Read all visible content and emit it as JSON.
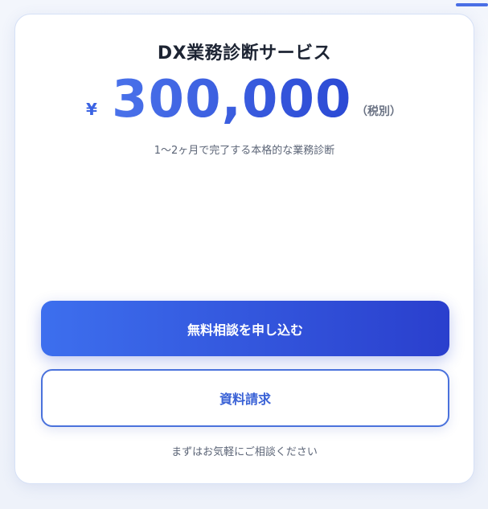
{
  "service": {
    "title": "DX業務診断サービス",
    "currency_symbol": "¥",
    "price": "300,000",
    "tax_note": "（税別）",
    "subtitle": "1〜2ヶ月で完了する本格的な業務診断"
  },
  "actions": {
    "primary_label": "無料相談を申し込む",
    "secondary_label": "資料請求"
  },
  "footer": {
    "note": "まずはお気軽にご相談ください"
  },
  "colors": {
    "accent": "#3b63e3",
    "primary_button_start": "#3d6fee",
    "primary_button_end": "#2a3fcd",
    "text_dark": "#1d2433",
    "text_muted": "#5c6577"
  }
}
